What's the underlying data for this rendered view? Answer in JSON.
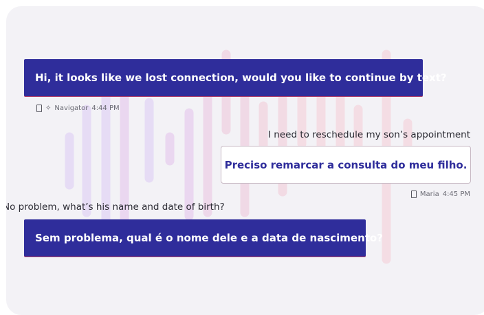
{
  "messages": [
    {
      "text": "Hi, it looks like we lost connection, would you like to continue by text?",
      "sender": "Navigator",
      "time": "4:44 PM",
      "sender_icons": [
        "phone-icon",
        "sparkle-icon"
      ]
    },
    {
      "original": "I need to reschedule my son’s appointment",
      "translation": "Preciso remarcar a consulta do meu filho.",
      "sender": "Maria",
      "time": "4:45 PM",
      "sender_icons": [
        "phone-icon"
      ]
    },
    {
      "original": "No problem, what’s his name and date of birth?",
      "translation": "Sem problema, qual é o nome dele e a data de nascimento?"
    }
  ],
  "colors": {
    "accent": "#2f2d9b",
    "panel_bg": "#f3f2f6",
    "waveform_purple": "#e6dcf5",
    "waveform_pink": "#f4dde4"
  }
}
